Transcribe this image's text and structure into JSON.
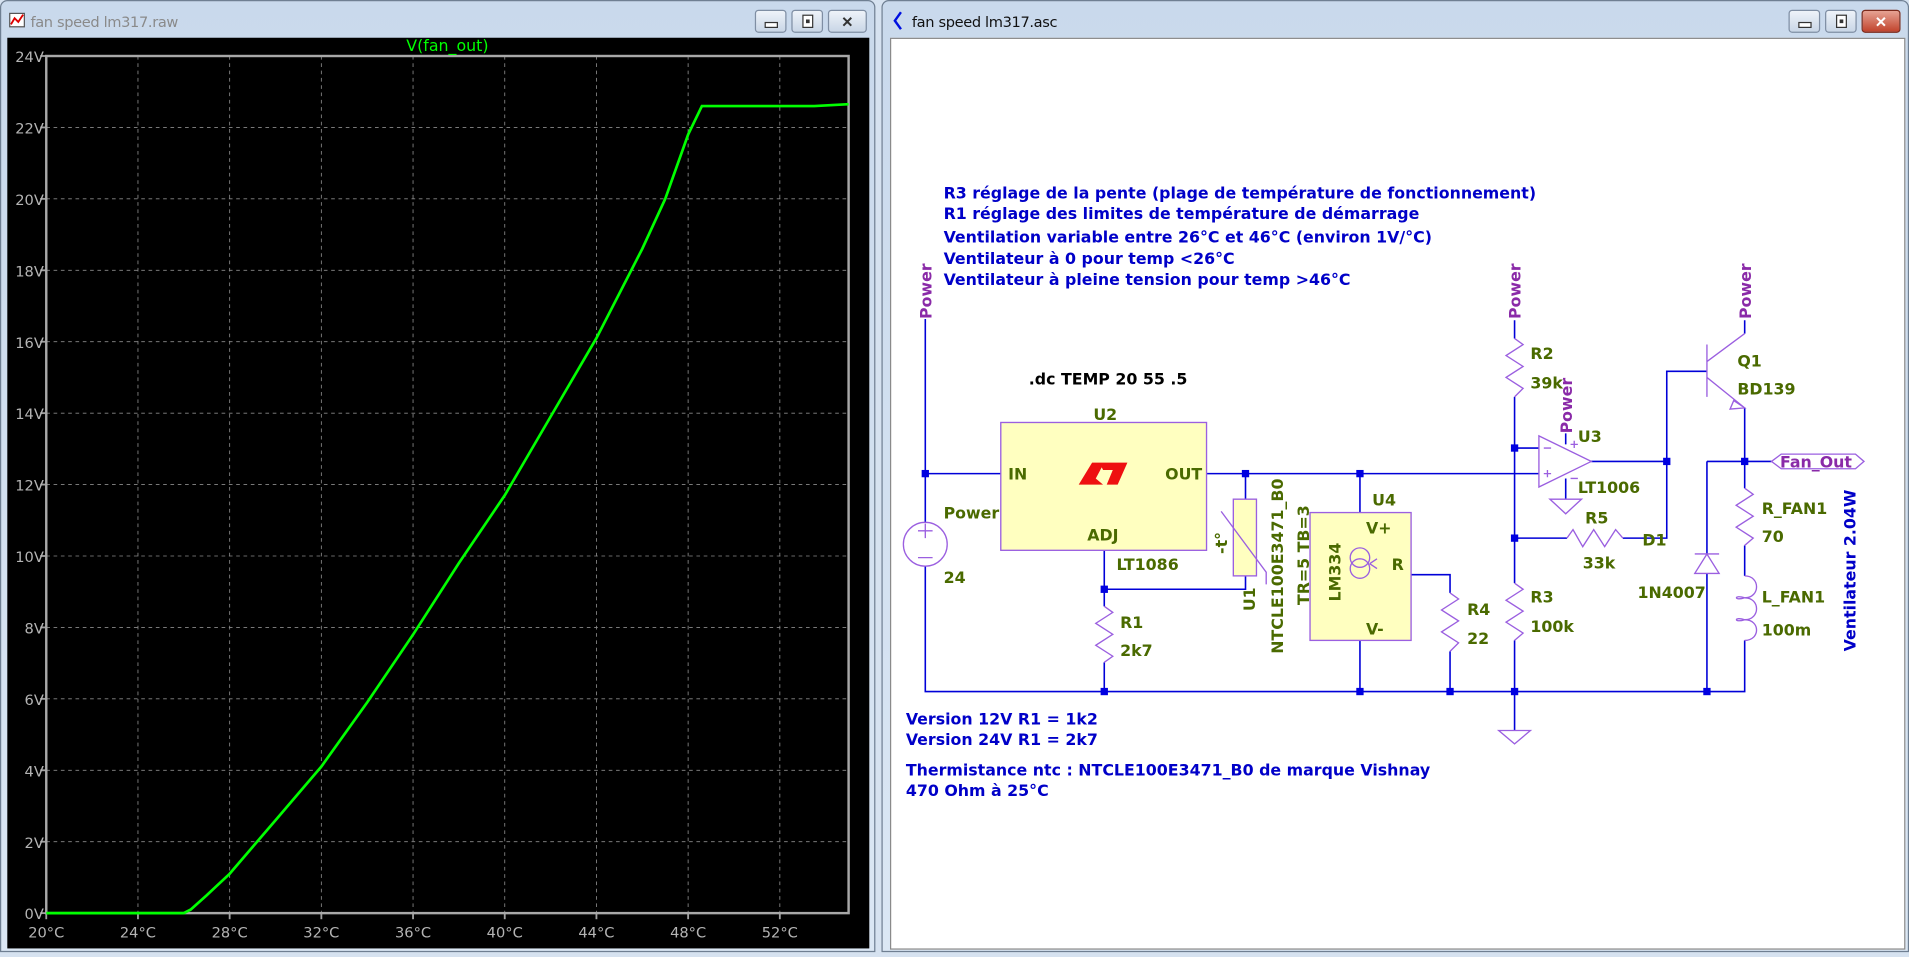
{
  "plot_window": {
    "title": "fan speed lm317.raw"
  },
  "schematic_window": {
    "title": "fan speed lm317.asc"
  },
  "chart_data": {
    "type": "line",
    "title": "V(fan_out)",
    "xlabel": "",
    "ylabel": "",
    "xlim": [
      20,
      55
    ],
    "ylim": [
      0,
      24
    ],
    "grid": true,
    "x_ticks": [
      "20°C",
      "24°C",
      "28°C",
      "32°C",
      "36°C",
      "40°C",
      "44°C",
      "48°C",
      "52°C"
    ],
    "x_tick_values": [
      20,
      24,
      28,
      32,
      36,
      40,
      44,
      48,
      52
    ],
    "y_ticks": [
      "0V",
      "2V",
      "4V",
      "6V",
      "8V",
      "10V",
      "12V",
      "14V",
      "16V",
      "18V",
      "20V",
      "22V",
      "24V"
    ],
    "y_tick_values": [
      0,
      2,
      4,
      6,
      8,
      10,
      12,
      14,
      16,
      18,
      20,
      22,
      24
    ],
    "series": [
      {
        "name": "V(fan_out)",
        "color": "#00ff00",
        "x": [
          20,
          26,
          26.3,
          27,
          28,
          30,
          32,
          34,
          36,
          38,
          40,
          42,
          44,
          46,
          47,
          48,
          48.6,
          49,
          53.5,
          55
        ],
        "y": [
          0,
          0,
          0.1,
          0.5,
          1.1,
          2.6,
          4.1,
          5.9,
          7.8,
          9.8,
          11.7,
          13.9,
          16.1,
          18.6,
          20.0,
          21.8,
          22.6,
          22.6,
          22.6,
          22.65
        ]
      }
    ]
  },
  "schematic": {
    "notes": [
      "R3 réglage de la pente (plage de température de fonctionnement)",
      "R1 réglage des limites de température de démarrage",
      "Ventilation variable entre 26°C et 46°C (environ 1V/°C)",
      "Ventilateur à 0 pour temp <26°C",
      "Ventilateur à pleine tension pour temp >46°C"
    ],
    "directive": ".dc TEMP 20 55 .5",
    "bottom_notes": [
      "Version 12V R1 = 1k2",
      "Version 24V R1 = 2k7",
      "Thermistance ntc : NTCLE100E3471_B0 de marque  Vishnay",
      "470 Ohm à 25°C"
    ],
    "power_flag": "Power",
    "fan_out_label": "Fan_Out",
    "fan_note": "Ventilateur 2.04W",
    "v1": {
      "name": "Power",
      "value": "24"
    },
    "u2": {
      "name": "U2",
      "model": "LT1086",
      "pin_in": "IN",
      "pin_out": "OUT",
      "pin_adj": "ADJ"
    },
    "r1": {
      "name": "R1",
      "value": "2k7"
    },
    "u1": {
      "name": "U1",
      "model": "NTCLE100E3471_B0",
      "params": "TR=5 TB=3",
      "symbol": "-t°"
    },
    "u4": {
      "name": "U4",
      "model": "LM334",
      "pin_vp": "V+",
      "pin_vm": "V-",
      "pin_r": "R"
    },
    "r4": {
      "name": "R4",
      "value": "22"
    },
    "r2": {
      "name": "R2",
      "value": "39k"
    },
    "r3": {
      "name": "R3",
      "value": "100k"
    },
    "r5": {
      "name": "R5",
      "value": "33k"
    },
    "u3": {
      "name": "U3",
      "model": "LT1006"
    },
    "q1": {
      "name": "Q1",
      "model": "BD139"
    },
    "d1": {
      "name": "D1",
      "model": "1N4007"
    },
    "rfan": {
      "name": "R_FAN1",
      "value": "70"
    },
    "lfan": {
      "name": "L_FAN1",
      "value": "100m"
    },
    "colors": {
      "wire": "#0000d8",
      "component": "#9b5fe0",
      "label": "#4a6a00",
      "note": "#0000c8",
      "flag": "#8a2aa8"
    }
  }
}
